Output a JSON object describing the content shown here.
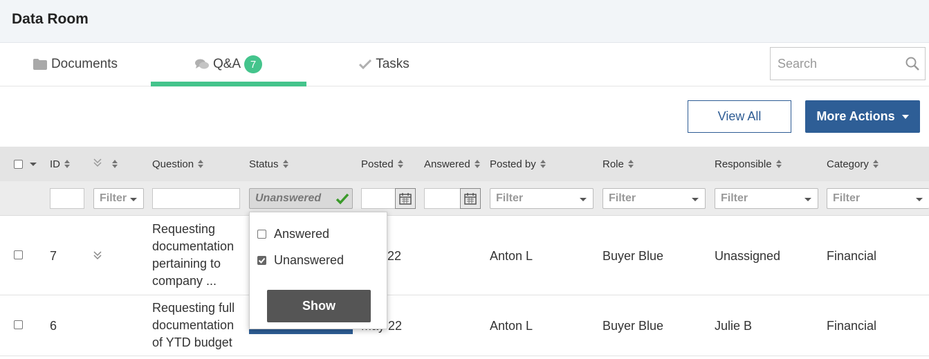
{
  "header": {
    "title": "Data Room"
  },
  "tabs": [
    {
      "label": "Documents",
      "icon": "folder-icon"
    },
    {
      "label": "Q&A",
      "icon": "chat-icon",
      "badge": "7",
      "active": true
    },
    {
      "label": "Tasks",
      "icon": "check-icon"
    }
  ],
  "search": {
    "placeholder": "Search"
  },
  "toolbar": {
    "view_all_label": "View All",
    "more_actions_label": "More Actions"
  },
  "columns": [
    "ID",
    "Question",
    "Status",
    "Posted",
    "Answered",
    "Posted by",
    "Role",
    "Responsible",
    "Category"
  ],
  "filters": {
    "status_value": "Unanswered",
    "placeholder": "Filter"
  },
  "status_popup": {
    "options": [
      {
        "label": "Answered",
        "checked": false
      },
      {
        "label": "Unanswered",
        "checked": true
      }
    ],
    "show_label": "Show"
  },
  "rows": [
    {
      "id": "7",
      "question_lines": [
        "Requesting",
        "documentation",
        "pertaining to",
        "company ..."
      ],
      "posted_partial": "22",
      "posted_by": "Anton L",
      "role": "Buyer Blue",
      "responsible": "Unassigned",
      "category": "Financial"
    },
    {
      "id": "6",
      "question_lines": [
        "Requesting full",
        "documentation",
        "of YTD budget"
      ],
      "posted_partial": "May 22",
      "posted_by": "Anton L",
      "role": "Buyer Blue",
      "responsible": "Julie B",
      "category": "Financial"
    }
  ],
  "colors": {
    "accent_green": "#44c48c",
    "primary_blue": "#2e5e96"
  }
}
